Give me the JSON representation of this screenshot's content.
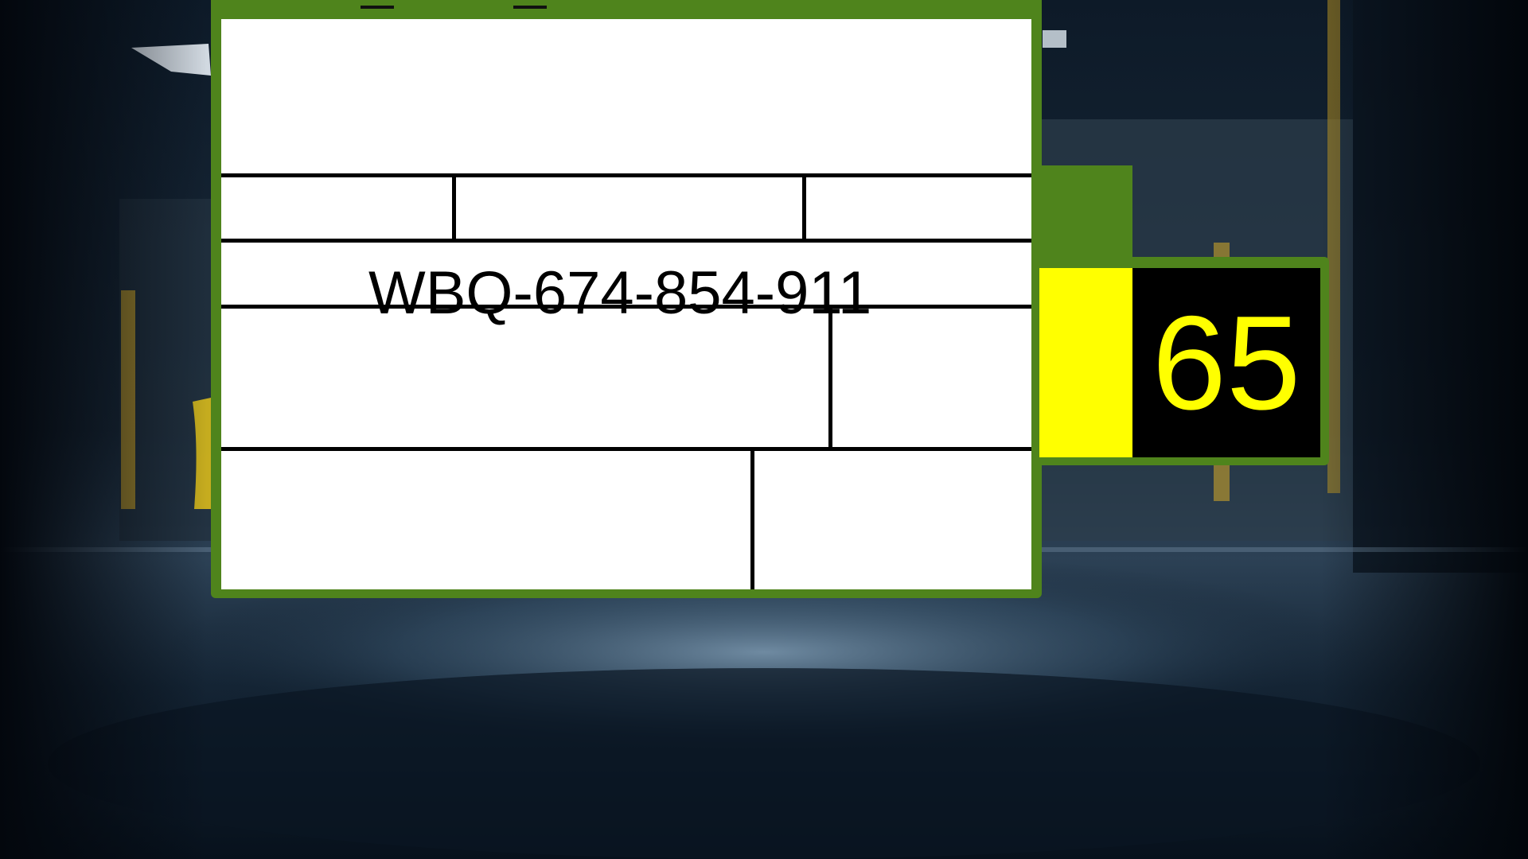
{
  "plate": {
    "id_text": "WBQ-674-854-911"
  },
  "side_panel": {
    "value": "65"
  },
  "colors": {
    "frame_green": "#4f841c",
    "indicator_yellow": "#ffff00",
    "readout_black": "#000000",
    "plate_white": "#ffffff"
  }
}
